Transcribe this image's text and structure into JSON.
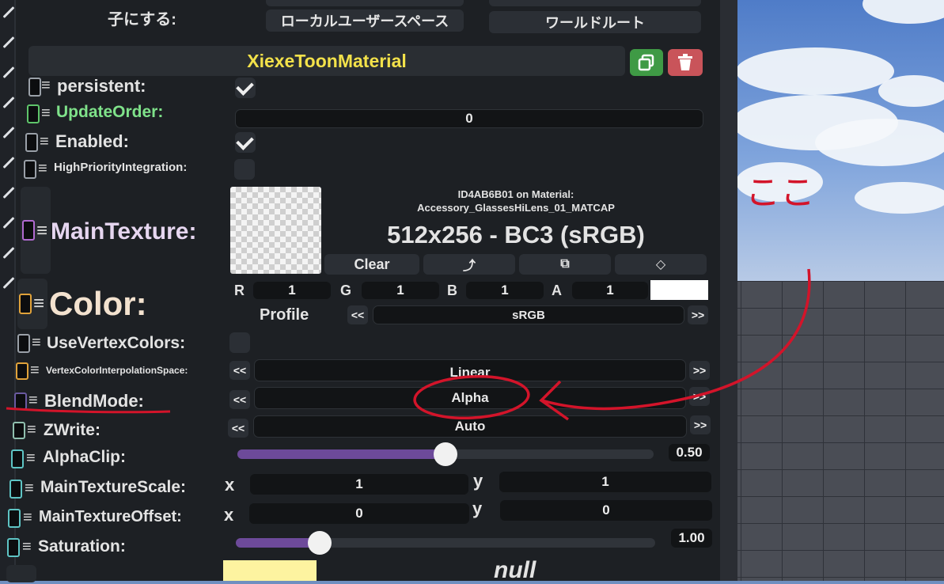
{
  "top": {
    "parent_label": "子にする:",
    "local_space_button": "ローカルユーザースペース",
    "world_root_button": "ワールドルート"
  },
  "component": {
    "name": "XiexeToonMaterial",
    "accent_color": "#f2e14a"
  },
  "rows": {
    "persistent": {
      "label": "persistent:",
      "checked": true
    },
    "update_order": {
      "label": "UpdateOrder:",
      "value": "0",
      "color": "#7fe28a"
    },
    "enabled": {
      "label": "Enabled:",
      "checked": true
    },
    "high_priority": {
      "label": "HighPriorityIntegration:"
    },
    "main_texture": {
      "label": "MainTexture:",
      "info_line1": "ID4AB6B01 on Material:",
      "info_line2": "Accessory_GlassesHiLens_01_MATCAP",
      "format": "512x256 - BC3 (sRGB)",
      "clear_label": "Clear"
    },
    "color": {
      "label": "Color:",
      "r_label": "R",
      "r": "1",
      "g_label": "G",
      "g": "1",
      "b_label": "B",
      "b": "1",
      "a_label": "A",
      "a": "1",
      "profile_label": "Profile",
      "profile_value": "sRGB"
    },
    "use_vertex_colors": {
      "label": "UseVertexColors:"
    },
    "vertex_interp": {
      "label": "VertexColorInterpolationSpace:",
      "value": "Linear"
    },
    "blend_mode": {
      "label": "BlendMode:",
      "value": "Alpha"
    },
    "zwrite": {
      "label": "ZWrite:",
      "value": "Auto"
    },
    "alpha_clip": {
      "label": "AlphaClip:",
      "value": "0.50",
      "fraction": 0.5
    },
    "main_texture_scale": {
      "label": "MainTextureScale:",
      "x_label": "x",
      "x": "1",
      "y_label": "y",
      "y": "1"
    },
    "main_texture_offset": {
      "label": "MainTextureOffset:",
      "x_label": "x",
      "x": "0",
      "y_label": "y",
      "y": "0"
    },
    "saturation": {
      "label": "Saturation:",
      "value": "1.00",
      "fraction": 0.2
    },
    "next": {
      "value": "null"
    }
  },
  "annotation": {
    "text": "ここ",
    "color": "#d3142a"
  },
  "icons": {
    "nav": "chevron-double-left-icon",
    "nav_right": "chevron-double-right-icon",
    "duplicate": "duplicate-icon",
    "delete": "trash-icon",
    "reference": "arrow-up-icon",
    "copy": "copy-icon",
    "tag": "tag-icon"
  }
}
